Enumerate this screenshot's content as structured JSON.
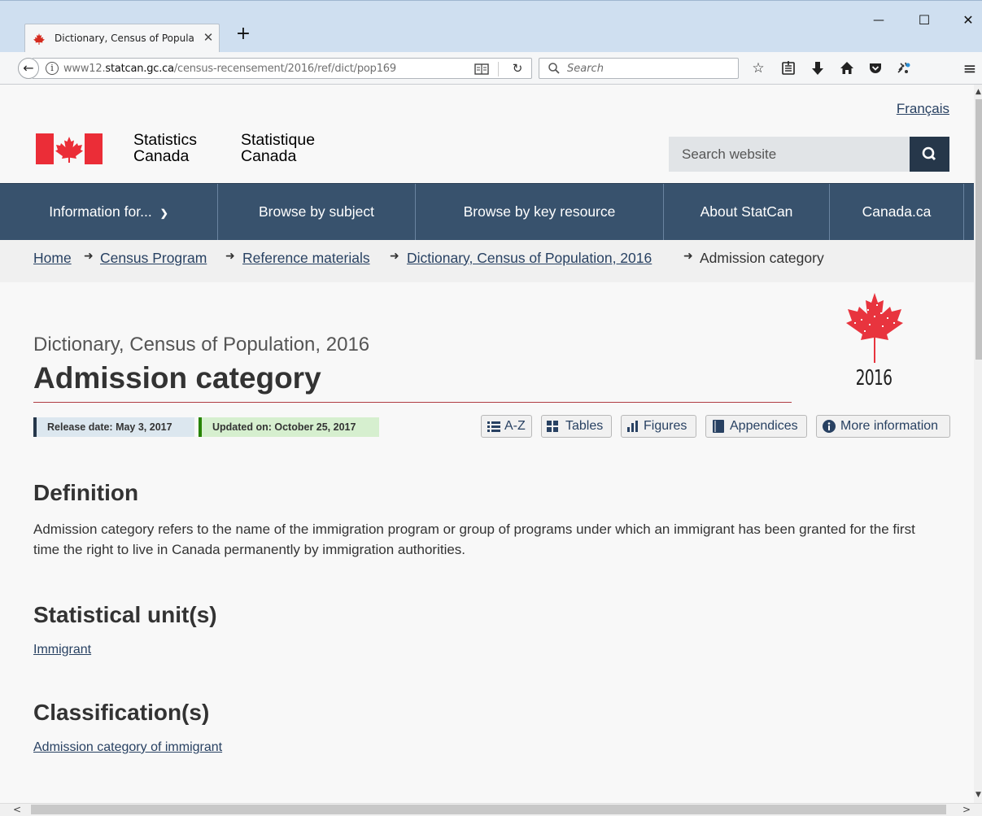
{
  "browser": {
    "tab_title": "Dictionary, Census of Popula",
    "tab_close": "✕",
    "new_tab": "+",
    "win_minimize": "—",
    "win_maximize": "☐",
    "win_close": "✕",
    "url_prefix": "www12.",
    "url_domain": "statcan.gc.ca",
    "url_path": "/census-recensement/2016/ref/dict/pop169",
    "search_placeholder": "Search",
    "icons": [
      "back-icon",
      "info-icon",
      "reader-view-icon",
      "reload-icon",
      "search-icon",
      "bookmark-star-icon",
      "reading-list-icon",
      "download-icon",
      "home-icon",
      "pocket-icon",
      "extension-icon",
      "menu-icon"
    ]
  },
  "header": {
    "language_link": "Français",
    "wordmark_en_line1": "Statistics",
    "wordmark_en_line2": "Canada",
    "wordmark_fr_line1": "Statistique",
    "wordmark_fr_line2": "Canada",
    "search_placeholder": "Search website",
    "brand_red": "#eb2d37"
  },
  "mainnav": {
    "items": [
      {
        "label": "Information for..."
      },
      {
        "label": "Browse by subject"
      },
      {
        "label": "Browse by key resource"
      },
      {
        "label": "About StatCan"
      },
      {
        "label": "Canada.ca"
      }
    ],
    "background": "#38526d"
  },
  "breadcrumb": {
    "items": [
      "Home",
      "Census Program",
      "Reference materials",
      "Dictionary, Census of Population, 2016"
    ],
    "current": "Admission category",
    "arrow": "➜"
  },
  "page": {
    "subtitle": "Dictionary, Census of Population, 2016",
    "title": "Admission category",
    "logo_year": "2016",
    "release_date": "Release date: May 3, 2017",
    "updated_on": "Updated on: October 25, 2017",
    "tools": {
      "az": "A-Z",
      "tables": "Tables",
      "figures": "Figures",
      "appendices": "Appendices",
      "more_info": "More information"
    }
  },
  "sections": {
    "definition_heading": "Definition",
    "definition_text": "Admission category refers to the name of the immigration program or group of programs under which an immigrant has been granted for the first time the right to live in Canada permanently by immigration authorities.",
    "statistical_units_heading": "Statistical unit(s)",
    "statistical_units_link": "Immigrant",
    "classifications_heading": "Classification(s)",
    "classifications_link": "Admission category of immigrant"
  }
}
